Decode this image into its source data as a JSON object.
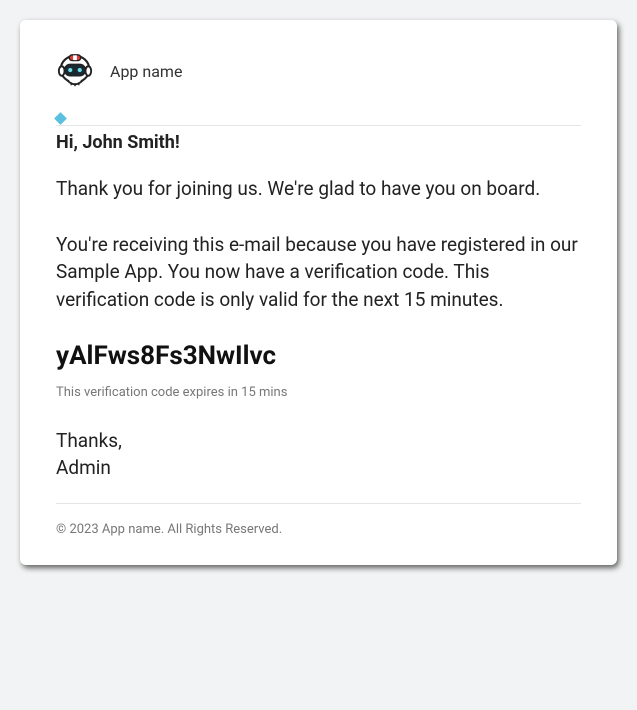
{
  "header": {
    "app_name": "App name"
  },
  "greeting": "Hi, John Smith!",
  "paragraph1": "Thank you for joining us. We're glad to have you on board.",
  "paragraph2": "You're receiving this e-mail because you have registered in our Sample App. You now have a verification code. This verification code is only valid for the next 15 minutes.",
  "verification_code": "yAlFws8Fs3NwIlvc",
  "expiry_note": "This verification code expires in 15 mins",
  "signoff_thanks": "Thanks,",
  "signoff_name": "Admin",
  "footer": "© 2023 App name. All Rights Reserved."
}
